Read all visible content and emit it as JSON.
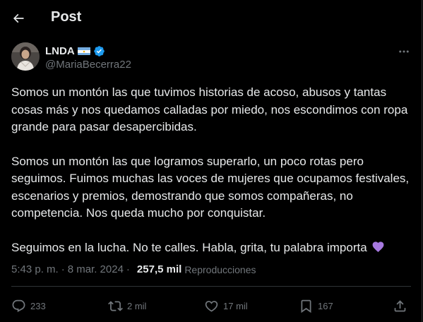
{
  "header": {
    "title": "Post",
    "back_icon": "arrow-left-icon"
  },
  "author": {
    "display_name": "LNDA",
    "handle": "@MariaBecerra22",
    "flag": "argentina-flag",
    "verified_color": "#1d9bf0"
  },
  "tweet": {
    "paragraphs": [
      "Somos un montón las que tuvimos historias de acoso, abusos y tantas cosas más y nos quedamos calladas por miedo, nos escondimos con ropa grande para pasar desapercibidas.",
      "Somos un montón las que logramos superarlo, un poco rotas pero seguimos. Fuimos muchas las voces de mujeres que ocupamos festivales, escenarios y premios, demostrando que somos compañeras, no competencia. Nos queda mucho por conquistar.",
      "Seguimos en la lucha. No te calles. Habla, grita, tu palabra importa"
    ],
    "emoji": "purple-heart"
  },
  "meta": {
    "time": "5:43 p. m.",
    "separator": "·",
    "date": "8 mar. 2024",
    "views_count": "257,5 mil",
    "views_label": "Reproducciones"
  },
  "actions": {
    "replies": "233",
    "reposts": "2 mil",
    "likes": "17 mil",
    "bookmarks": "167"
  },
  "colors": {
    "background": "#000000",
    "text": "#e7e9ea",
    "muted": "#71767b",
    "border": "#2f3336",
    "accent": "#1d9bf0",
    "heart": "#a779e0"
  }
}
